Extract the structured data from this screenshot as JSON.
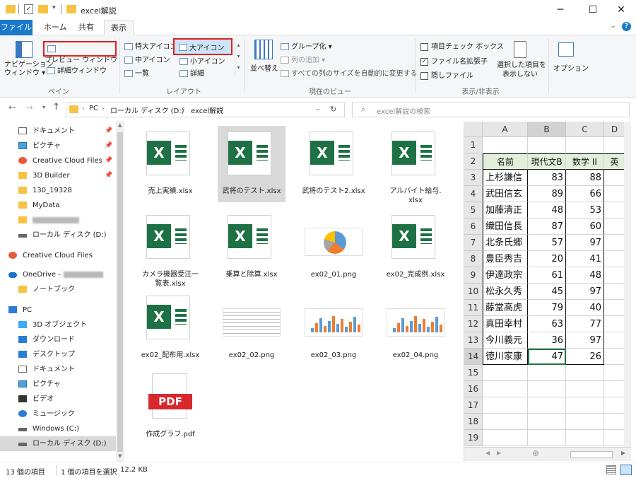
{
  "window": {
    "title": "excel解説",
    "minimize": "─",
    "maximize": "☐",
    "close": "✕"
  },
  "tabs": [
    "ファイル",
    "ホーム",
    "共有",
    "表示"
  ],
  "ribbon": {
    "pane": {
      "nav_pane": "ナビゲーション\nウィンドウ ▾",
      "nav_pane_l1": "ナビゲーション",
      "nav_pane_l2": "ウィンドウ ▾",
      "preview": "プレビュー ウィンドウ",
      "details": "詳細ウィンドウ",
      "label": "ペイン"
    },
    "layout": {
      "xl": "特大アイコン",
      "large": "大アイコン",
      "medium": "中アイコン",
      "small": "小アイコン",
      "list": "一覧",
      "details": "詳細",
      "label": "レイアウト"
    },
    "current_view": {
      "sort": "並べ替え",
      "group": "グループ化 ▾",
      "add_column": "列の追加 ▾",
      "autosize": "すべての列のサイズを自動的に変更する",
      "label": "現在のビュー"
    },
    "show_hide": {
      "item_checkbox": "項目チェック ボックス",
      "extensions": "ファイル名拡張子",
      "hidden": "隠しファイル",
      "hide_selected_l1": "選択した項目を",
      "hide_selected_l2": "表示しない",
      "label": "表示/非表示"
    },
    "options": "オプション"
  },
  "address": {
    "crumbs": [
      "PC",
      "ローカル ディスク (D:)",
      "excel解説"
    ],
    "search_placeholder": "excel解説の検索"
  },
  "nav": {
    "items": [
      {
        "label": "ドキュメント",
        "pinned": true
      },
      {
        "label": "ピクチャ",
        "pinned": true
      },
      {
        "label": "Creative Cloud Files",
        "pinned": true
      },
      {
        "label": "3D Builder",
        "pinned": true
      },
      {
        "label": "130_19328",
        "pinned": false
      },
      {
        "label": "MyData",
        "pinned": false
      },
      {
        "label": "",
        "pinned": false
      },
      {
        "label": "ローカル ディスク (D:)",
        "pinned": false
      },
      {
        "label": "Creative Cloud Files",
        "pinned": false
      },
      {
        "label": "OneDrive -",
        "pinned": false
      },
      {
        "label": "ノートブック",
        "pinned": false
      },
      {
        "label": "PC",
        "pinned": false
      },
      {
        "label": "3D オブジェクト",
        "pinned": false
      },
      {
        "label": "ダウンロード",
        "pinned": false
      },
      {
        "label": "デスクトップ",
        "pinned": false
      },
      {
        "label": "ドキュメント",
        "pinned": false
      },
      {
        "label": "ピクチャ",
        "pinned": false
      },
      {
        "label": "ビデオ",
        "pinned": false
      },
      {
        "label": "ミュージック",
        "pinned": false
      },
      {
        "label": "Windows (C:)",
        "pinned": false
      },
      {
        "label": "ローカル ディスク (D:)",
        "pinned": false
      }
    ]
  },
  "files": [
    {
      "name": "売上実績.xlsx",
      "kind": "xlsx"
    },
    {
      "name": "武将のテスト.xlsx",
      "kind": "xlsx"
    },
    {
      "name": "武将のテスト2.xlsx",
      "kind": "xlsx"
    },
    {
      "name": "アルバイト給与.\nxlsx",
      "kind": "xlsx"
    },
    {
      "name": "カメラ機器受注一\n覧表.xlsx",
      "kind": "xlsx"
    },
    {
      "name": "乗算と除算.xlsx",
      "kind": "xlsx"
    },
    {
      "name": "ex02_01.png",
      "kind": "png-pie"
    },
    {
      "name": "ex02_完成例.xlsx",
      "kind": "xlsx"
    },
    {
      "name": "ex02_配布用.xlsx",
      "kind": "xlsx"
    },
    {
      "name": "ex02_02.png",
      "kind": "png-table"
    },
    {
      "name": "ex02_03.png",
      "kind": "png-bar"
    },
    {
      "name": "ex02_04.png",
      "kind": "png-bar"
    },
    {
      "name": "作成グラフ.pdf",
      "kind": "pdf"
    }
  ],
  "pdf_badge": "PDF",
  "preview": {
    "cols": [
      "A",
      "B",
      "C",
      "D"
    ],
    "header": [
      "名前",
      "現代文B",
      "数学 II",
      "英"
    ],
    "rows": [
      [
        "上杉謙信",
        "83",
        "88"
      ],
      [
        "武田信玄",
        "89",
        "66"
      ],
      [
        "加藤清正",
        "48",
        "53"
      ],
      [
        "織田信長",
        "87",
        "60"
      ],
      [
        "北条氏郷",
        "57",
        "97"
      ],
      [
        "豊臣秀吉",
        "20",
        "41"
      ],
      [
        "伊達政宗",
        "61",
        "48"
      ],
      [
        "松永久秀",
        "45",
        "97"
      ],
      [
        "藤堂高虎",
        "79",
        "40"
      ],
      [
        "真田幸村",
        "63",
        "77"
      ],
      [
        "今川義元",
        "36",
        "97"
      ],
      [
        "徳川家康",
        "47",
        "26"
      ]
    ],
    "row_numbers": [
      "1",
      "2",
      "3",
      "4",
      "5",
      "6",
      "7",
      "8",
      "9",
      "10",
      "11",
      "12",
      "13",
      "14",
      "15",
      "16",
      "17",
      "18",
      "19"
    ]
  },
  "status": {
    "count": "13 個の項目",
    "selected": "1 個の項目を選択",
    "size": "12.2 KB"
  },
  "colors": {
    "excel_green": "#1e7145",
    "accent_blue": "#1979ca",
    "highlight_red": "#e02020",
    "pdf_red": "#d9272e",
    "selection": "#d9d9d9"
  }
}
